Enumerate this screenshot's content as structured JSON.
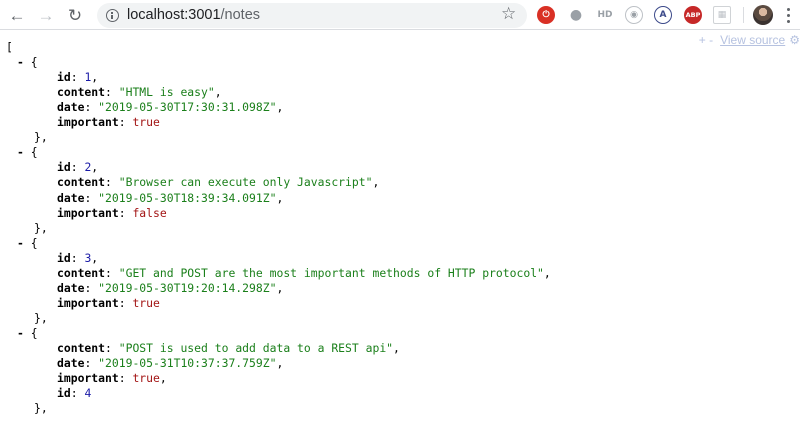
{
  "browser": {
    "back_icon": "←",
    "forward_icon": "→",
    "reload_icon": "↻",
    "url_host": "localhost:3001",
    "url_path": "/notes",
    "star_icon": "☆",
    "extensions": {
      "ext1": "⏻",
      "ext2": "●",
      "ext3": "HD",
      "ext4": "◉",
      "ext5": "A",
      "ext6": "ABP",
      "ext7": "▦"
    }
  },
  "viewer": {
    "toolbar": {
      "collapse_toggles": "+ -",
      "view_source": "View source",
      "gear": "⚙"
    },
    "open_bracket": "[",
    "toggle": "-",
    "notes": [
      {
        "fields": [
          {
            "key": "id",
            "value": "1",
            "type": "number",
            "comma": ","
          },
          {
            "key": "content",
            "value": "\"HTML is easy\"",
            "type": "string",
            "comma": ","
          },
          {
            "key": "date",
            "value": "\"2019-05-30T17:30:31.098Z\"",
            "type": "string",
            "comma": ","
          },
          {
            "key": "important",
            "value": "true",
            "type": "bool",
            "comma": ""
          }
        ]
      },
      {
        "fields": [
          {
            "key": "id",
            "value": "2",
            "type": "number",
            "comma": ","
          },
          {
            "key": "content",
            "value": "\"Browser can execute only Javascript\"",
            "type": "string",
            "comma": ","
          },
          {
            "key": "date",
            "value": "\"2019-05-30T18:39:34.091Z\"",
            "type": "string",
            "comma": ","
          },
          {
            "key": "important",
            "value": "false",
            "type": "bool",
            "comma": ""
          }
        ]
      },
      {
        "fields": [
          {
            "key": "id",
            "value": "3",
            "type": "number",
            "comma": ","
          },
          {
            "key": "content",
            "value": "\"GET and POST are the most important methods of HTTP protocol\"",
            "type": "string",
            "comma": ","
          },
          {
            "key": "date",
            "value": "\"2019-05-30T19:20:14.298Z\"",
            "type": "string",
            "comma": ","
          },
          {
            "key": "important",
            "value": "true",
            "type": "bool",
            "comma": ""
          }
        ]
      },
      {
        "fields": [
          {
            "key": "content",
            "value": "\"POST is used to add data to a REST api\"",
            "type": "string",
            "comma": ","
          },
          {
            "key": "date",
            "value": "\"2019-05-31T10:37:37.759Z\"",
            "type": "string",
            "comma": ","
          },
          {
            "key": "important",
            "value": "true",
            "type": "bool",
            "comma": ","
          },
          {
            "key": "id",
            "value": "4",
            "type": "number",
            "comma": ""
          }
        ]
      }
    ]
  }
}
